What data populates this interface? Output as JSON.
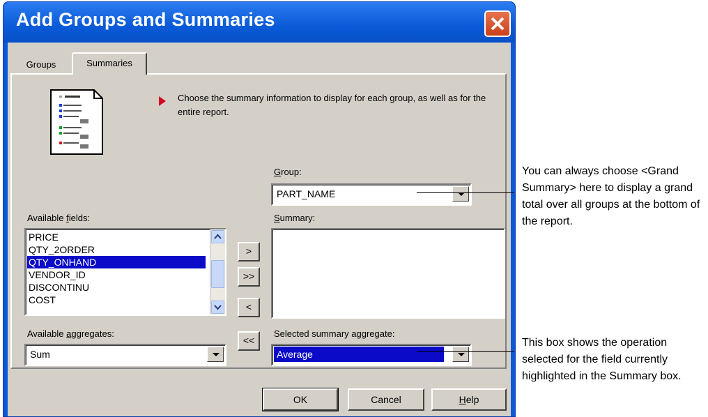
{
  "dialog": {
    "title": "Add Groups and Summaries",
    "tabs": [
      {
        "label": "Groups"
      },
      {
        "label": "Summaries"
      }
    ],
    "instruction": "Choose the summary information to display for each group, as well as for the entire report.",
    "group": {
      "label_pre": "",
      "label_accel": "G",
      "label_post": "roup:",
      "value": "PART_NAME"
    },
    "available_fields": {
      "label_pre": "Available ",
      "label_accel": "f",
      "label_post": "ields:",
      "items": [
        "PRICE",
        "QTY_2ORDER",
        "QTY_ONHAND",
        "VENDOR_ID",
        "DISCONTINU",
        "COST"
      ],
      "selected": "QTY_ONHAND"
    },
    "summary": {
      "label_pre": "",
      "label_accel": "S",
      "label_post": "ummary:",
      "items": []
    },
    "move_buttons": {
      "add": ">",
      "add_all": ">>",
      "remove": "<",
      "remove_all": "<<"
    },
    "available_aggregates": {
      "label_pre": "Available ",
      "label_accel": "a",
      "label_post": "ggregates:",
      "value": "Sum"
    },
    "selected_aggregate": {
      "label": "Selected summary aggregate:",
      "value": "Average"
    },
    "buttons": {
      "ok": "OK",
      "cancel": "Cancel",
      "help_accel": "H",
      "help_post": "elp"
    }
  },
  "annotations": {
    "group_note": "You can always choose <Grand Summary> here to display a grand total over all groups at the bottom of the report.",
    "aggregate_note": "This box shows the operation selected for the field currently highlighted in the Summary box."
  },
  "colors": {
    "titlebar": "#0a5ad8",
    "face": "#d4d0c8",
    "selection": "#0a0ac8",
    "bullet": "#d4001e"
  }
}
